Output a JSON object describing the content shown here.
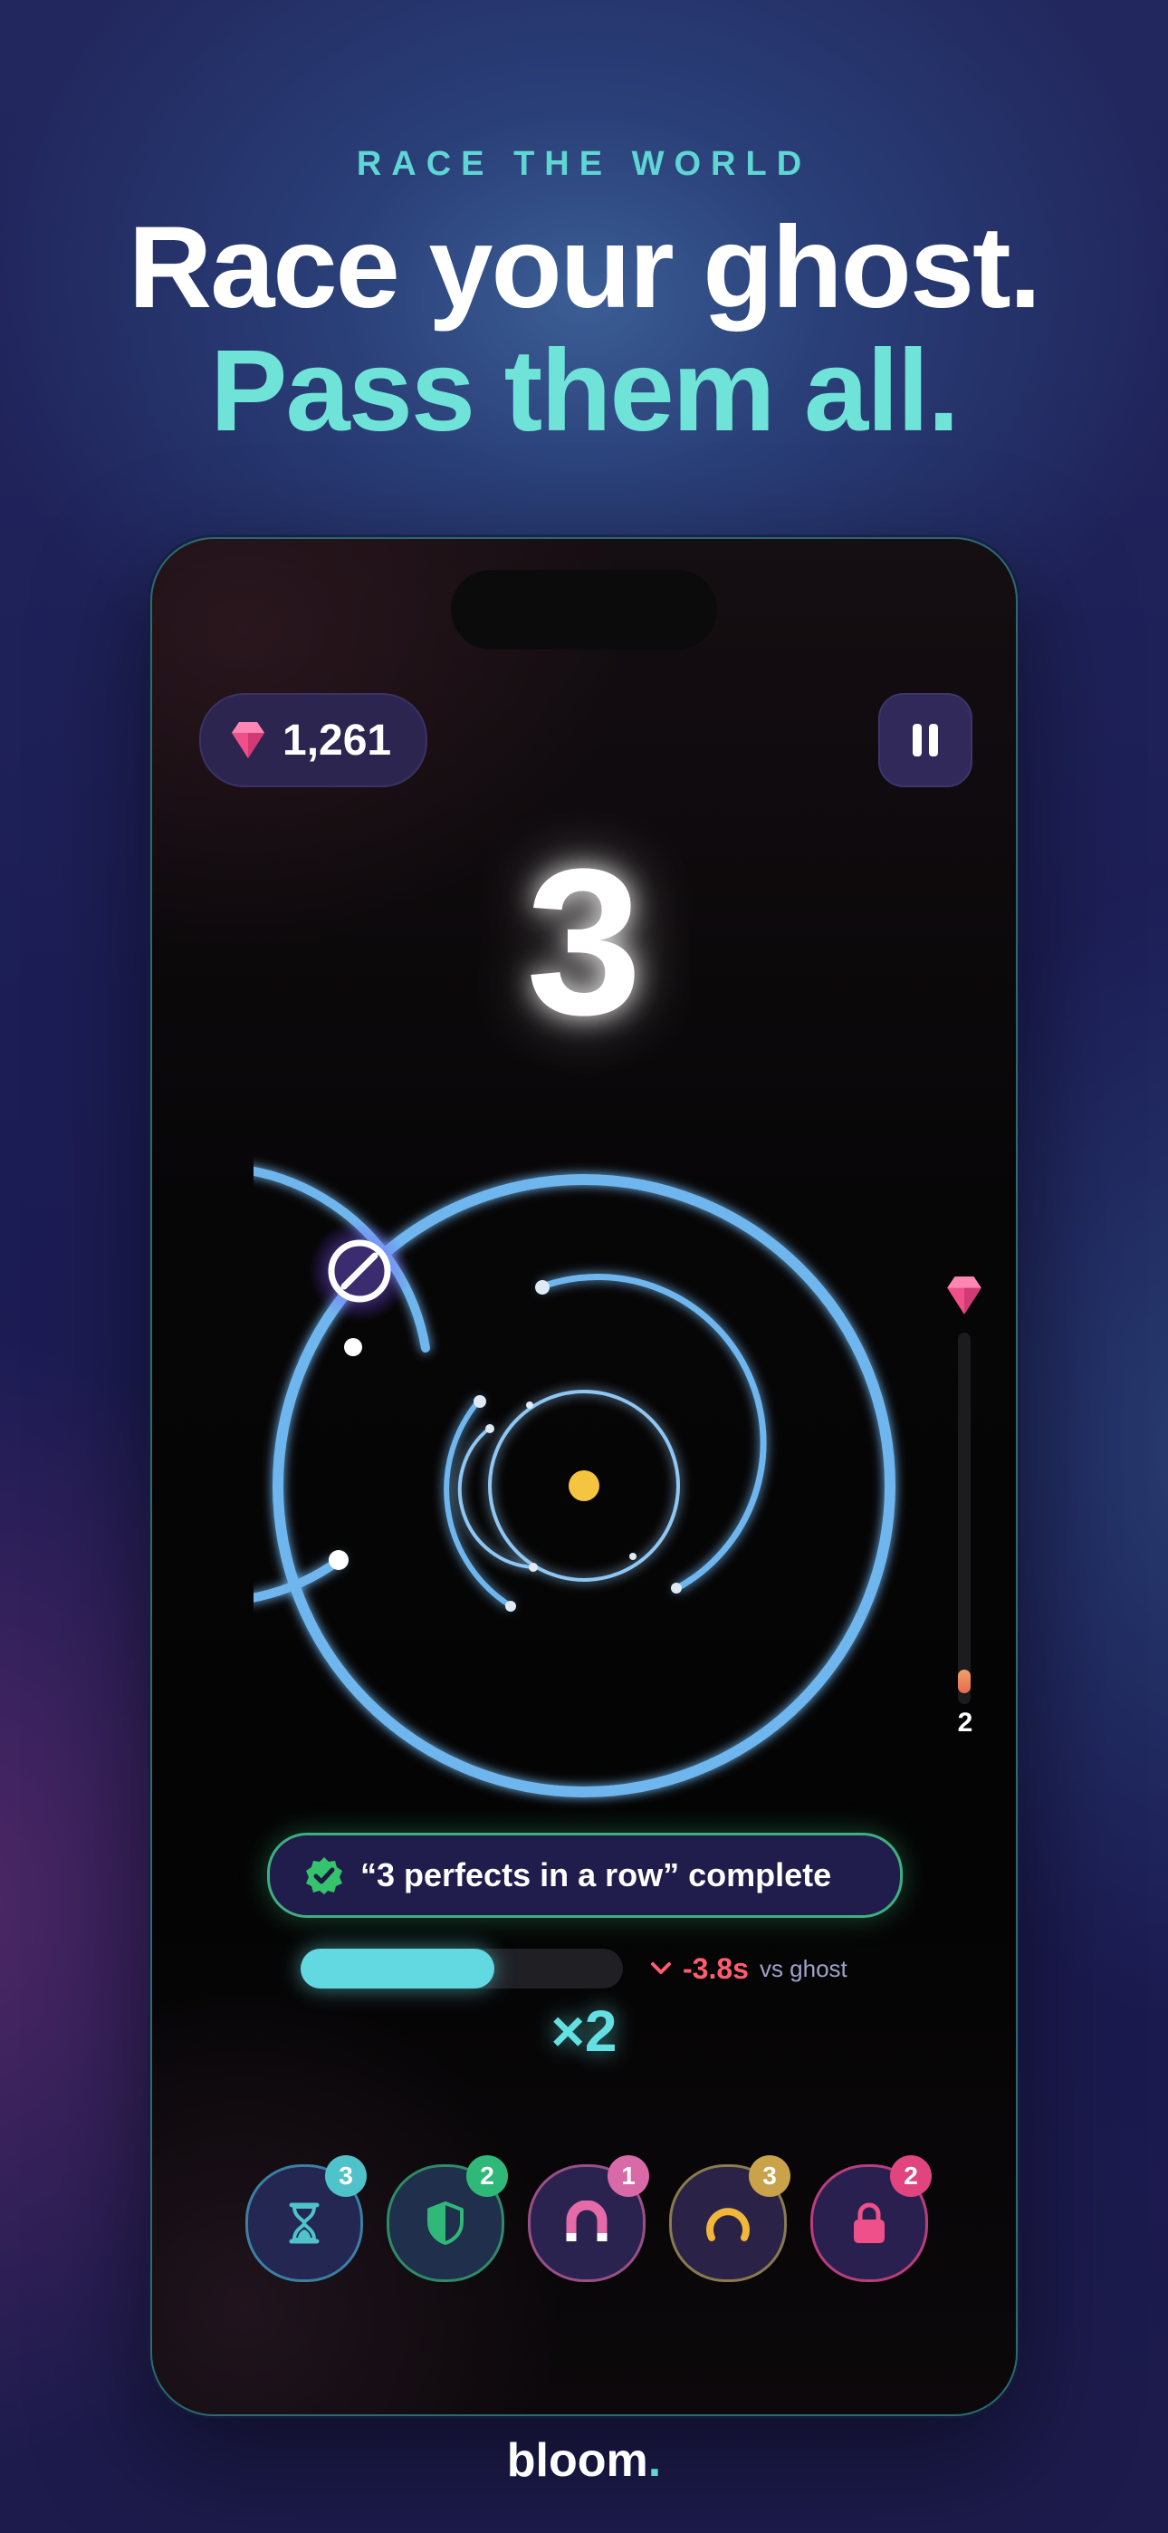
{
  "header": {
    "eyebrow": "RACE THE WORLD",
    "headline_line1": "Race your ghost.",
    "headline_line2": "Pass them all."
  },
  "game": {
    "gems": "1,261",
    "countdown": "3",
    "level_progress_label": "2",
    "toast_text": "“3 perfects in a row” complete",
    "ghost_progress": 0.6,
    "ghost_delta": "-3.8s",
    "ghost_label": "vs ghost",
    "multiplier": "×2",
    "powerups": [
      {
        "icon": "hourglass-icon",
        "count": "3",
        "accent": "#4fc3c9"
      },
      {
        "icon": "shield-icon",
        "count": "2",
        "accent": "#2fb878"
      },
      {
        "icon": "magnet-icon",
        "count": "1",
        "accent": "#d86aa8"
      },
      {
        "icon": "ring-icon",
        "count": "3",
        "accent": "#c9a24a"
      },
      {
        "icon": "lock-icon",
        "count": "2",
        "accent": "#e0457f"
      }
    ]
  },
  "brand": {
    "name": "bloom",
    "dot": "."
  },
  "colors": {
    "accent_teal": "#6fe3d8",
    "ring_blue": "#6fb6ee",
    "center_yellow": "#f5c542",
    "gem_pink": "#f0508a",
    "delta_red": "#ff5d6e"
  }
}
